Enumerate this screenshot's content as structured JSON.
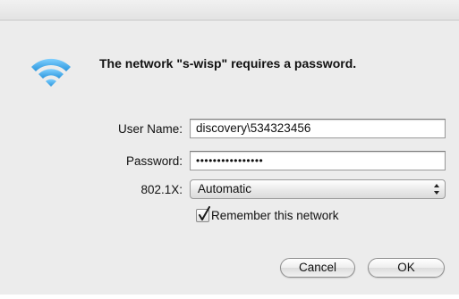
{
  "dialog": {
    "heading": "The network \"s-wisp\" requires a password.",
    "icon": "wifi-icon"
  },
  "form": {
    "username_label": "User Name:",
    "username_value": "discovery\\534323456",
    "password_label": "Password:",
    "password_value": "••••••••••••••••",
    "security_label": "802.1X:",
    "security_value": "Automatic",
    "remember_label": "Remember this network",
    "remember_checked": true
  },
  "buttons": {
    "cancel": "Cancel",
    "ok": "OK"
  },
  "colors": {
    "wifi_blue": "#3fa9e8",
    "dialog_bg": "#ececec"
  }
}
